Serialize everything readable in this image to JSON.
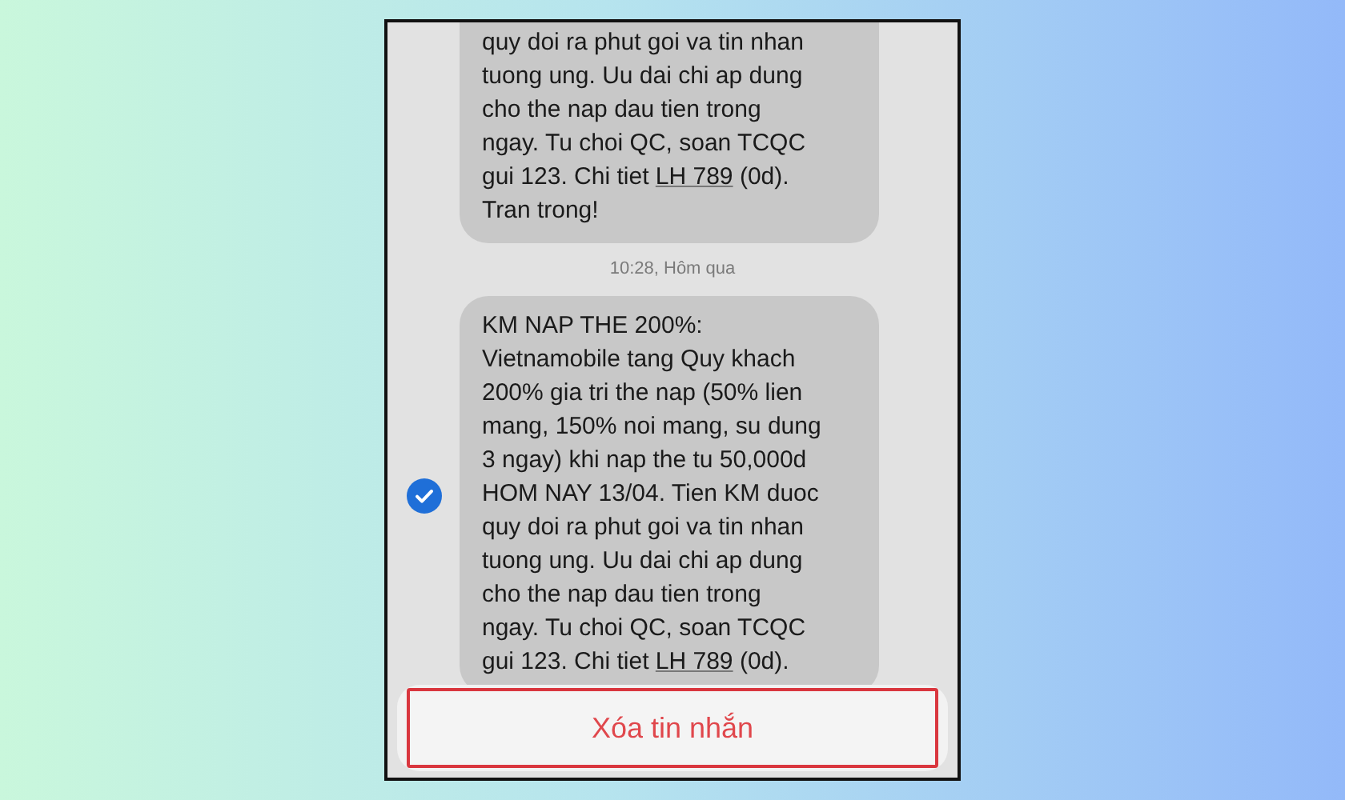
{
  "messages": [
    {
      "lines": [
        {
          "kind": "text",
          "text": "quy doi ra phut goi va tin nhan"
        },
        {
          "kind": "text",
          "text": "tuong ung. Uu dai chi ap dung"
        },
        {
          "kind": "text",
          "text": "cho the nap dau tien trong"
        },
        {
          "kind": "text",
          "text": "ngay. Tu choi QC, soan TCQC"
        },
        {
          "kind": "link",
          "before": "gui 123. Chi tiet ",
          "link": "LH 789",
          "after": " (0d)."
        },
        {
          "kind": "text",
          "text": "Tran trong!"
        }
      ]
    },
    {
      "timestamp": "10:28, Hôm qua",
      "selected": true,
      "lines": [
        {
          "kind": "text",
          "text": "KM NAP THE 200%:"
        },
        {
          "kind": "text",
          "text": "Vietnamobile tang Quy khach"
        },
        {
          "kind": "text",
          "text": "200% gia tri the nap (50% lien"
        },
        {
          "kind": "text",
          "text": "mang, 150% noi mang, su dung"
        },
        {
          "kind": "text",
          "text": "3 ngay) khi nap the tu 50,000d"
        },
        {
          "kind": "text",
          "text": "HOM NAY 13/04. Tien KM duoc"
        },
        {
          "kind": "text",
          "text": "quy doi ra phut goi va tin nhan"
        },
        {
          "kind": "text",
          "text": "tuong ung. Uu dai chi ap dung"
        },
        {
          "kind": "text",
          "text": "cho the nap dau tien trong"
        },
        {
          "kind": "text",
          "text": "ngay. Tu choi QC, soan TCQC"
        },
        {
          "kind": "link",
          "before": "gui 123. Chi tiet ",
          "link": "LH 789",
          "after": " (0d)."
        }
      ]
    }
  ],
  "action": {
    "label": "Xóa tin nhắn"
  }
}
